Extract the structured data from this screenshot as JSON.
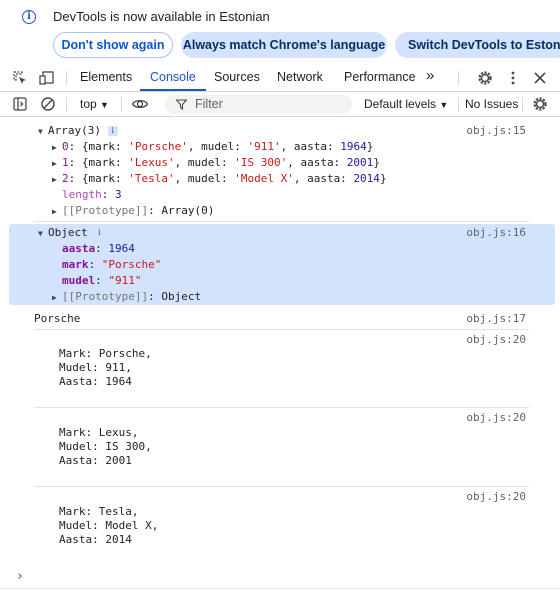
{
  "infobar": {
    "message": "DevTools is now available in Estonian",
    "buttons": [
      "Don't show again",
      "Always match Chrome's language",
      "Switch DevTools to Estonian"
    ]
  },
  "tabs": {
    "items": [
      "Elements",
      "Console",
      "Sources",
      "Network",
      "Performance"
    ],
    "active": "Console",
    "more": "»"
  },
  "console_toolbar": {
    "context": "top",
    "filter_placeholder": "Filter",
    "levels": "Default levels",
    "issues": "No Issues"
  },
  "log": {
    "array_entry": {
      "summary": "Array(3)",
      "source": "obj.js:15",
      "items": [
        {
          "index": "0",
          "mark": "'Porsche'",
          "mudel": "'911'",
          "aasta": "1964"
        },
        {
          "index": "1",
          "mark": "'Lexus'",
          "mudel": "'IS 300'",
          "aasta": "2001"
        },
        {
          "index": "2",
          "mark": "'Tesla'",
          "mudel": "'Model X'",
          "aasta": "2014"
        }
      ],
      "length_key": "length",
      "length_val": "3",
      "proto_key": "[[Prototype]]",
      "proto_val": "Array(0)"
    },
    "object_entry": {
      "summary": "Object",
      "source": "obj.js:16",
      "aasta_key": "aasta",
      "aasta_val": "1964",
      "mark_key": "mark",
      "mark_val": "\"Porsche\"",
      "mudel_key": "mudel",
      "mudel_val": "\"911\"",
      "proto_key": "[[Prototype]]",
      "proto_val": "Object"
    },
    "porsche_entry": {
      "text": "Porsche",
      "source": "obj.js:17"
    },
    "cards": [
      {
        "source": "obj.js:20",
        "l1": "Mark: Porsche,",
        "l2": "Mudel: 911,",
        "l3": "Aasta: 1964"
      },
      {
        "source": "obj.js:20",
        "l1": "Mark: Lexus,",
        "l2": "Mudel: IS 300,",
        "l3": "Aasta: 2001"
      },
      {
        "source": "obj.js:20",
        "l1": "Mark: Tesla,",
        "l2": "Mudel: Model X,",
        "l3": "Aasta: 2014"
      }
    ],
    "prompt": "›"
  }
}
